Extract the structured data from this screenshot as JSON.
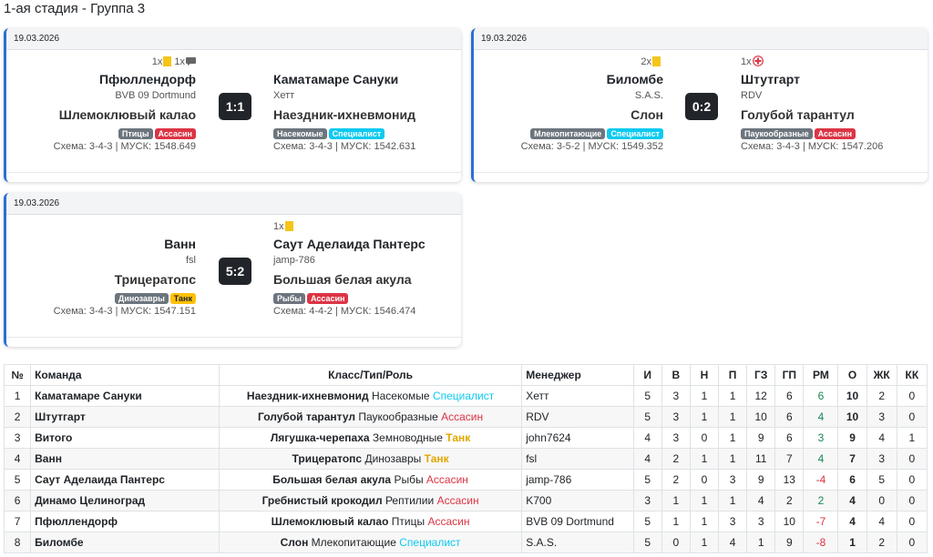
{
  "page_title": "1-ая стадия - Группа 3",
  "colors": {
    "accent": "#2b6fd6",
    "assassin": "#dc3545",
    "specialist": "#0dcaf0",
    "tank": "#ffc107",
    "type": "#6c757d",
    "positive": "#198754"
  },
  "matches": [
    {
      "date": "19.03.2026",
      "score": "1:1",
      "home": {
        "cards": [
          {
            "count": "1x",
            "icon": "yellow-card-icon"
          },
          {
            "count": "1x",
            "icon": "chat-icon"
          }
        ],
        "name": "Пфюллендорф",
        "manager": "BVB 09 Dortmund",
        "class": "Шлемоклювый калао",
        "type": "Птицы",
        "role": "Ассасин",
        "role_kind": "assassin",
        "scheme": "Схема: 3-4-3 | МУСК: 1548.649"
      },
      "away": {
        "cards": [],
        "name": "Каматамаре Сануки",
        "manager": "Хетт",
        "class": "Наездник-ихневмонид",
        "type": "Насекомые",
        "role": "Специалист",
        "role_kind": "spec",
        "scheme": "Схема: 3-4-3 | МУСК: 1542.631"
      }
    },
    {
      "date": "19.03.2026",
      "score": "0:2",
      "home": {
        "cards": [
          {
            "count": "2x",
            "icon": "yellow-card-icon"
          }
        ],
        "name": "Биломбе",
        "manager": "S.A.S.",
        "class": "Слон",
        "type": "Млекопитающие",
        "role": "Специалист",
        "role_kind": "spec",
        "scheme": "Схема: 3-5-2 | МУСК: 1549.352"
      },
      "away": {
        "cards": [
          {
            "count": "1x",
            "icon": "red-cross-icon"
          }
        ],
        "name": "Штутгарт",
        "manager": "RDV",
        "class": "Голубой тарантул",
        "type": "Паукообразные",
        "role": "Ассасин",
        "role_kind": "assassin",
        "scheme": "Схема: 3-4-3 | МУСК: 1547.206"
      }
    },
    {
      "date": "19.03.2026",
      "score": "5:2",
      "home": {
        "cards": [],
        "name": "Ванн",
        "manager": "fsl",
        "class": "Трицератопс",
        "type": "Динозавры",
        "role": "Танк",
        "role_kind": "tank",
        "scheme": "Схема: 3-4-3 | МУСК: 1547.151"
      },
      "away": {
        "cards": [
          {
            "count": "1x",
            "icon": "yellow-card-icon"
          }
        ],
        "name": "Саут Аделаида Пантерс",
        "manager": "jamp-786",
        "class": "Большая белая акула",
        "type": "Рыбы",
        "role": "Ассасин",
        "role_kind": "assassin",
        "scheme": "Схема: 4-4-2 | МУСК: 1546.474"
      }
    }
  ],
  "table": {
    "headers": [
      "№",
      "Команда",
      "Класс/Тип/Роль",
      "Менеджер",
      "И",
      "В",
      "Н",
      "П",
      "ГЗ",
      "ГП",
      "РМ",
      "О",
      "ЖК",
      "КК"
    ],
    "rows": [
      {
        "pos": "1",
        "team": "Каматамаре Сануки",
        "cls": "Наездник-ихневмонид",
        "type": "Насекомые",
        "role": "Специалист",
        "role_kind": "spec",
        "manager": "Хетт",
        "p": "5",
        "w": "3",
        "d": "1",
        "l": "1",
        "gf": "12",
        "ga": "6",
        "gd": "6",
        "pts": "10",
        "yc": "2",
        "rc": "0"
      },
      {
        "pos": "2",
        "team": "Штутгарт",
        "cls": "Голубой тарантул",
        "type": "Паукообразные",
        "role": "Ассасин",
        "role_kind": "assassin",
        "manager": "RDV",
        "p": "5",
        "w": "3",
        "d": "1",
        "l": "1",
        "gf": "10",
        "ga": "6",
        "gd": "4",
        "pts": "10",
        "yc": "3",
        "rc": "0"
      },
      {
        "pos": "3",
        "team": "Витого",
        "cls": "Лягушка-черепаха",
        "type": "Земноводные",
        "role": "Танк",
        "role_kind": "tank",
        "manager": "john7624",
        "p": "4",
        "w": "3",
        "d": "0",
        "l": "1",
        "gf": "9",
        "ga": "6",
        "gd": "3",
        "pts": "9",
        "yc": "4",
        "rc": "1"
      },
      {
        "pos": "4",
        "team": "Ванн",
        "cls": "Трицератопс",
        "type": "Динозавры",
        "role": "Танк",
        "role_kind": "tank",
        "manager": "fsl",
        "p": "4",
        "w": "2",
        "d": "1",
        "l": "1",
        "gf": "11",
        "ga": "7",
        "gd": "4",
        "pts": "7",
        "yc": "3",
        "rc": "0"
      },
      {
        "pos": "5",
        "team": "Саут Аделаида Пантерс",
        "cls": "Большая белая акула",
        "type": "Рыбы",
        "role": "Ассасин",
        "role_kind": "assassin",
        "manager": "jamp-786",
        "p": "5",
        "w": "2",
        "d": "0",
        "l": "3",
        "gf": "9",
        "ga": "13",
        "gd": "-4",
        "pts": "6",
        "yc": "5",
        "rc": "0"
      },
      {
        "pos": "6",
        "team": "Динамо Целиноград",
        "cls": "Гребнистый крокодил",
        "type": "Рептилии",
        "role": "Ассасин",
        "role_kind": "assassin",
        "manager": "K700",
        "p": "3",
        "w": "1",
        "d": "1",
        "l": "1",
        "gf": "4",
        "ga": "2",
        "gd": "2",
        "pts": "4",
        "yc": "0",
        "rc": "0"
      },
      {
        "pos": "7",
        "team": "Пфюллендорф",
        "cls": "Шлемоклювый калао",
        "type": "Птицы",
        "role": "Ассасин",
        "role_kind": "assassin",
        "manager": "BVB 09 Dortmund",
        "p": "5",
        "w": "1",
        "d": "1",
        "l": "3",
        "gf": "3",
        "ga": "10",
        "gd": "-7",
        "pts": "4",
        "yc": "4",
        "rc": "0"
      },
      {
        "pos": "8",
        "team": "Биломбе",
        "cls": "Слон",
        "type": "Млекопитающие",
        "role": "Специалист",
        "role_kind": "spec",
        "manager": "S.A.S.",
        "p": "5",
        "w": "0",
        "d": "1",
        "l": "4",
        "gf": "1",
        "ga": "9",
        "gd": "-8",
        "pts": "1",
        "yc": "2",
        "rc": "0"
      }
    ]
  }
}
